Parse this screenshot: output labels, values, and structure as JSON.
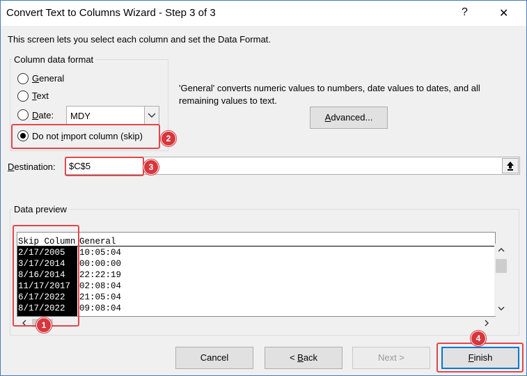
{
  "window": {
    "title": "Convert Text to Columns Wizard - Step 3 of 3",
    "help_glyph": "?",
    "close_glyph": "✕"
  },
  "intro": "This screen lets you select each column and set the Data Format.",
  "format_group": {
    "legend": "Column data format",
    "options": {
      "general": {
        "pre": "",
        "accel": "G",
        "post": "eneral"
      },
      "text": {
        "pre": "",
        "accel": "T",
        "post": "ext"
      },
      "date": {
        "pre": "",
        "accel": "D",
        "post": "ate:"
      },
      "skip": {
        "pre": "Do not ",
        "accel": "i",
        "post": "mport column (skip)"
      }
    },
    "date_value": "MDY",
    "selected": "skip"
  },
  "description": {
    "line1": "'General' converts numeric values to numbers, date values to dates, and all",
    "line2": "remaining values to text."
  },
  "advanced": {
    "pre": "",
    "accel": "A",
    "post": "dvanced..."
  },
  "destination": {
    "pre": "",
    "accel": "D",
    "post": "estination:",
    "value": "$C$5"
  },
  "preview": {
    "legend": "Data preview",
    "headers": [
      "Skip Column",
      "General"
    ],
    "rows": [
      [
        "2/17/2005",
        "10:05:04"
      ],
      [
        "3/17/2014",
        "00:00:00"
      ],
      [
        "8/16/2014",
        "22:22:19"
      ],
      [
        "11/17/2017",
        "02:08:04"
      ],
      [
        "6/17/2022",
        "21:05:04"
      ],
      [
        "8/17/2022",
        "09:08:04"
      ]
    ]
  },
  "buttons": {
    "cancel": "Cancel",
    "back": {
      "pre": "< ",
      "accel": "B",
      "post": "ack"
    },
    "next": "Next >",
    "finish": {
      "pre": "",
      "accel": "F",
      "post": "inish"
    }
  },
  "badges": [
    "1",
    "2",
    "3",
    "4"
  ],
  "colors": {
    "annotation_red": "#e0474c",
    "badge_red": "#d7363c",
    "selection_black": "#000000"
  }
}
